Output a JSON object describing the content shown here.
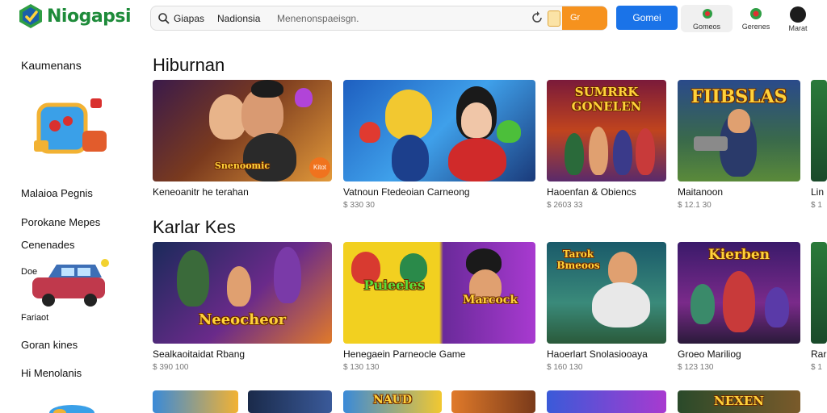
{
  "app": {
    "name": "Niogapsi"
  },
  "search": {
    "scope_1": "Giapas",
    "scope_2": "Nadionsia",
    "placeholder": "Menenonspaeisgn.",
    "go_label": "Gr"
  },
  "header": {
    "cta_label": "Gomei",
    "tile_1_label": "Gomeos",
    "tile_2_label": "Gerenes",
    "avatar_label": "Marat"
  },
  "sidebar": {
    "title": "Kaumenans",
    "items": [
      {
        "label": "Malaioa Pegnis"
      },
      {
        "label": "Porokane Mepes"
      },
      {
        "label": "Cenenades"
      },
      {
        "label": "Doe"
      },
      {
        "label": "Fariaot"
      },
      {
        "label": "Goran kines"
      },
      {
        "label": "Hi Menolanis"
      }
    ]
  },
  "sections": [
    {
      "title": "Hiburnan",
      "cards": [
        {
          "title": "Keneoanitr he terahan",
          "meta": "",
          "art_text": "Snenoomic",
          "badge": "Kitot"
        },
        {
          "title": "Vatnoun Ftedeoian Carneong",
          "meta": "$ 330 30",
          "art_text": "",
          "badge": ""
        },
        {
          "title": "Haoenfan & Obiencs",
          "meta": "$ 2603 33",
          "art_text": "SUMRRK GONELEN",
          "badge": ""
        },
        {
          "title": "Maitanoon",
          "meta": "$ 12.1 30",
          "art_text": "FIIBSLAS",
          "badge": ""
        },
        {
          "title": "Lin",
          "meta": "$ 1",
          "art_text": "",
          "badge": ""
        }
      ]
    },
    {
      "title": "Karlar Kes",
      "cards": [
        {
          "title": "Sealkaoitaidat Rbang",
          "meta": "$ 390 100",
          "art_text": "Neeocheor",
          "badge": ""
        },
        {
          "title": "Henegaein Parneocle Game",
          "meta": "$ 130 130",
          "art_text": "Puieeles",
          "badge": ""
        },
        {
          "title": "Haoerlart Snolasiooaya",
          "meta": "$ 160 130",
          "art_text": "Marcock",
          "badge": ""
        },
        {
          "title": "Groeo Mariliog",
          "meta": "$ 123 130",
          "art_text": "Tarok Bmeoos",
          "badge": ""
        },
        {
          "title": "Rar",
          "meta": "$ 1",
          "art_text": "Kierben",
          "badge": ""
        }
      ]
    }
  ],
  "row3": {
    "art_text_1": "NAUD",
    "art_text_2": "NEXEN"
  },
  "colors": {
    "brand": "#1e8b3a",
    "accent": "#1a73e8",
    "orange": "#f6921e"
  }
}
